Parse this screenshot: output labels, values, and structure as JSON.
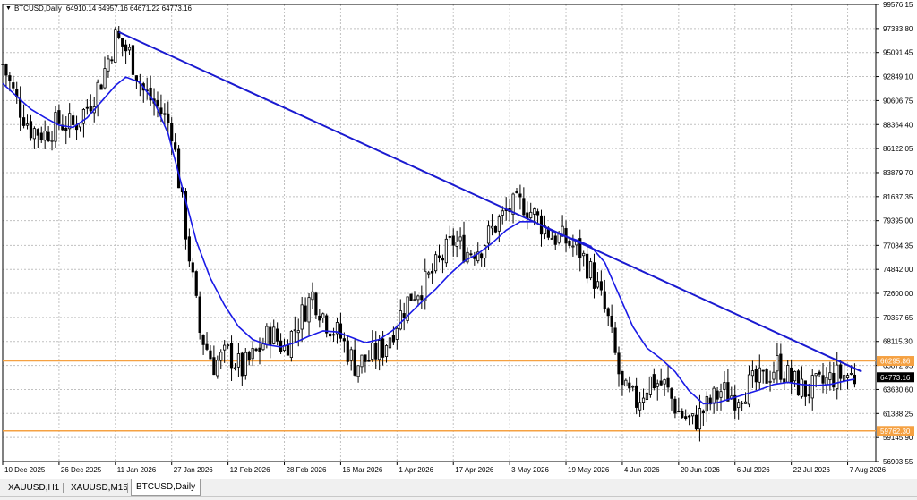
{
  "header": {
    "symbol_label": "BTCUSD,Daily",
    "ohlc_values": "64910.14 64957.16 64671.22 64773.16"
  },
  "tabs": [
    {
      "label": "XAUUSD,H1",
      "active": false
    },
    {
      "label": "XAUUSD,M15",
      "active": false
    },
    {
      "label": "BTCUSD,Daily",
      "active": true
    }
  ],
  "colors": {
    "candle": "#000000",
    "moving_average": "#1a1ae6",
    "trendline": "#1a1ad0",
    "horizontal_line": "#f5a142",
    "grid": "#c0c0c0",
    "price_tag_bg": "#000000",
    "level_tag_bg": "#f5a142"
  },
  "chart_data": {
    "type": "candlestick",
    "symbol": "BTCUSD",
    "timeframe": "Daily",
    "ylim": [
      56903.55,
      99576.15
    ],
    "y_ticks": [
      "99576.15",
      "97333.80",
      "95091.45",
      "92849.10",
      "90606.75",
      "88364.40",
      "86122.05",
      "83879.70",
      "81637.35",
      "79395.00",
      "77084.35",
      "74842.00",
      "72600.00",
      "70357.65",
      "68115.30",
      "65872.95",
      "63630.60",
      "61388.25",
      "59145.90",
      "56903.55"
    ],
    "x_ticks": [
      "10 Dec 2025",
      "26 Dec 2025",
      "11 Jan 2026",
      "27 Jan 2026",
      "12 Feb 2026",
      "28 Feb 2026",
      "16 Mar 2026",
      "1 Apr 2026",
      "17 Apr 2026",
      "3 May 2026",
      "19 May 2026",
      "4 Jun 2026",
      "20 Jun 2026",
      "6 Jul 2026",
      "22 Jul 2026",
      "7 Aug 2026"
    ],
    "x_range": [
      "2025-12-10",
      "2026-08-15"
    ],
    "current_price": "64773.16",
    "horizontal_levels": [
      {
        "price": "66295.86",
        "color": "#f5a142"
      },
      {
        "price": "59762.30",
        "color": "#f5a142"
      }
    ],
    "trendline": {
      "start": [
        "2026-01-12",
        97000
      ],
      "end": [
        "2026-08-11",
        65300
      ]
    },
    "close_path": [
      [
        "2025-12-10",
        94000
      ],
      [
        "2025-12-14",
        90500
      ],
      [
        "2025-12-18",
        88000
      ],
      [
        "2025-12-22",
        87500
      ],
      [
        "2025-12-26",
        88600
      ],
      [
        "2025-12-30",
        88200
      ],
      [
        "2026-01-03",
        90000
      ],
      [
        "2026-01-07",
        92500
      ],
      [
        "2026-01-11",
        96500
      ],
      [
        "2026-01-15",
        95000
      ],
      [
        "2026-01-19",
        91500
      ],
      [
        "2026-01-23",
        90000
      ],
      [
        "2026-01-27",
        88000
      ],
      [
        "2026-01-31",
        78500
      ],
      [
        "2026-02-04",
        69000
      ],
      [
        "2026-02-08",
        66000
      ],
      [
        "2026-02-12",
        67000
      ],
      [
        "2026-02-16",
        65500
      ],
      [
        "2026-02-20",
        67000
      ],
      [
        "2026-02-24",
        69000
      ],
      [
        "2026-02-28",
        67500
      ],
      [
        "2026-03-04",
        70000
      ],
      [
        "2026-03-08",
        72500
      ],
      [
        "2026-03-12",
        70000
      ],
      [
        "2026-03-16",
        68500
      ],
      [
        "2026-03-20",
        66000
      ],
      [
        "2026-03-24",
        66500
      ],
      [
        "2026-03-28",
        67500
      ],
      [
        "2026-04-01",
        70000
      ],
      [
        "2026-04-05",
        72500
      ],
      [
        "2026-04-09",
        73500
      ],
      [
        "2026-04-13",
        75500
      ],
      [
        "2026-04-17",
        77500
      ],
      [
        "2026-04-21",
        76500
      ],
      [
        "2026-04-25",
        77000
      ],
      [
        "2026-04-29",
        79000
      ],
      [
        "2026-05-03",
        80500
      ],
      [
        "2026-05-07",
        81000
      ],
      [
        "2026-05-11",
        79500
      ],
      [
        "2026-05-15",
        78000
      ],
      [
        "2026-05-19",
        77500
      ],
      [
        "2026-05-23",
        76500
      ],
      [
        "2026-05-27",
        74000
      ],
      [
        "2026-05-31",
        70000
      ],
      [
        "2026-06-04",
        63500
      ],
      [
        "2026-06-08",
        62500
      ],
      [
        "2026-06-12",
        64500
      ],
      [
        "2026-06-16",
        64000
      ],
      [
        "2026-06-20",
        61500
      ],
      [
        "2026-06-24",
        60500
      ],
      [
        "2026-06-28",
        62000
      ],
      [
        "2026-07-02",
        63500
      ],
      [
        "2026-07-06",
        63000
      ],
      [
        "2026-07-10",
        64000
      ],
      [
        "2026-07-14",
        64500
      ],
      [
        "2026-07-18",
        66000
      ],
      [
        "2026-07-22",
        64500
      ],
      [
        "2026-07-26",
        63500
      ],
      [
        "2026-07-30",
        64000
      ],
      [
        "2026-08-03",
        64800
      ],
      [
        "2026-08-07",
        65000
      ],
      [
        "2026-08-09",
        64773
      ]
    ],
    "moving_average_path": [
      [
        "2025-12-10",
        92200
      ],
      [
        "2025-12-14",
        91000
      ],
      [
        "2025-12-18",
        89800
      ],
      [
        "2025-12-22",
        89000
      ],
      [
        "2025-12-26",
        88300
      ],
      [
        "2025-12-30",
        88100
      ],
      [
        "2026-01-03",
        89000
      ],
      [
        "2026-01-07",
        90500
      ],
      [
        "2026-01-11",
        92000
      ],
      [
        "2026-01-14",
        92800
      ],
      [
        "2026-01-18",
        92300
      ],
      [
        "2026-01-22",
        90500
      ],
      [
        "2026-01-26",
        87500
      ],
      [
        "2026-01-30",
        82500
      ],
      [
        "2026-02-03",
        77500
      ],
      [
        "2026-02-07",
        74000
      ],
      [
        "2026-02-11",
        71500
      ],
      [
        "2026-02-15",
        69500
      ],
      [
        "2026-02-19",
        68300
      ],
      [
        "2026-02-23",
        67800
      ],
      [
        "2026-02-27",
        67600
      ],
      [
        "2026-03-03",
        68000
      ],
      [
        "2026-03-07",
        68600
      ],
      [
        "2026-03-11",
        69100
      ],
      [
        "2026-03-15",
        69000
      ],
      [
        "2026-03-19",
        68500
      ],
      [
        "2026-03-23",
        68000
      ],
      [
        "2026-03-27",
        68300
      ],
      [
        "2026-03-31",
        69200
      ],
      [
        "2026-04-04",
        70500
      ],
      [
        "2026-04-08",
        71800
      ],
      [
        "2026-04-12",
        73000
      ],
      [
        "2026-04-16",
        74400
      ],
      [
        "2026-04-20",
        75600
      ],
      [
        "2026-04-24",
        76300
      ],
      [
        "2026-04-28",
        77300
      ],
      [
        "2026-05-02",
        78500
      ],
      [
        "2026-05-06",
        79300
      ],
      [
        "2026-05-10",
        79300
      ],
      [
        "2026-05-14",
        78600
      ],
      [
        "2026-05-18",
        78000
      ],
      [
        "2026-05-22",
        77600
      ],
      [
        "2026-05-26",
        77000
      ],
      [
        "2026-05-30",
        75500
      ],
      [
        "2026-06-03",
        72500
      ],
      [
        "2026-06-07",
        69500
      ],
      [
        "2026-06-11",
        67500
      ],
      [
        "2026-06-15",
        66500
      ],
      [
        "2026-06-19",
        65300
      ],
      [
        "2026-06-23",
        63500
      ],
      [
        "2026-06-27",
        62300
      ],
      [
        "2026-07-01",
        62400
      ],
      [
        "2026-07-05",
        62800
      ],
      [
        "2026-07-09",
        63200
      ],
      [
        "2026-07-13",
        63600
      ],
      [
        "2026-07-17",
        64100
      ],
      [
        "2026-07-21",
        64300
      ],
      [
        "2026-07-25",
        64100
      ],
      [
        "2026-07-29",
        64000
      ],
      [
        "2026-08-02",
        64100
      ],
      [
        "2026-08-06",
        64400
      ],
      [
        "2026-08-09",
        64600
      ]
    ]
  }
}
